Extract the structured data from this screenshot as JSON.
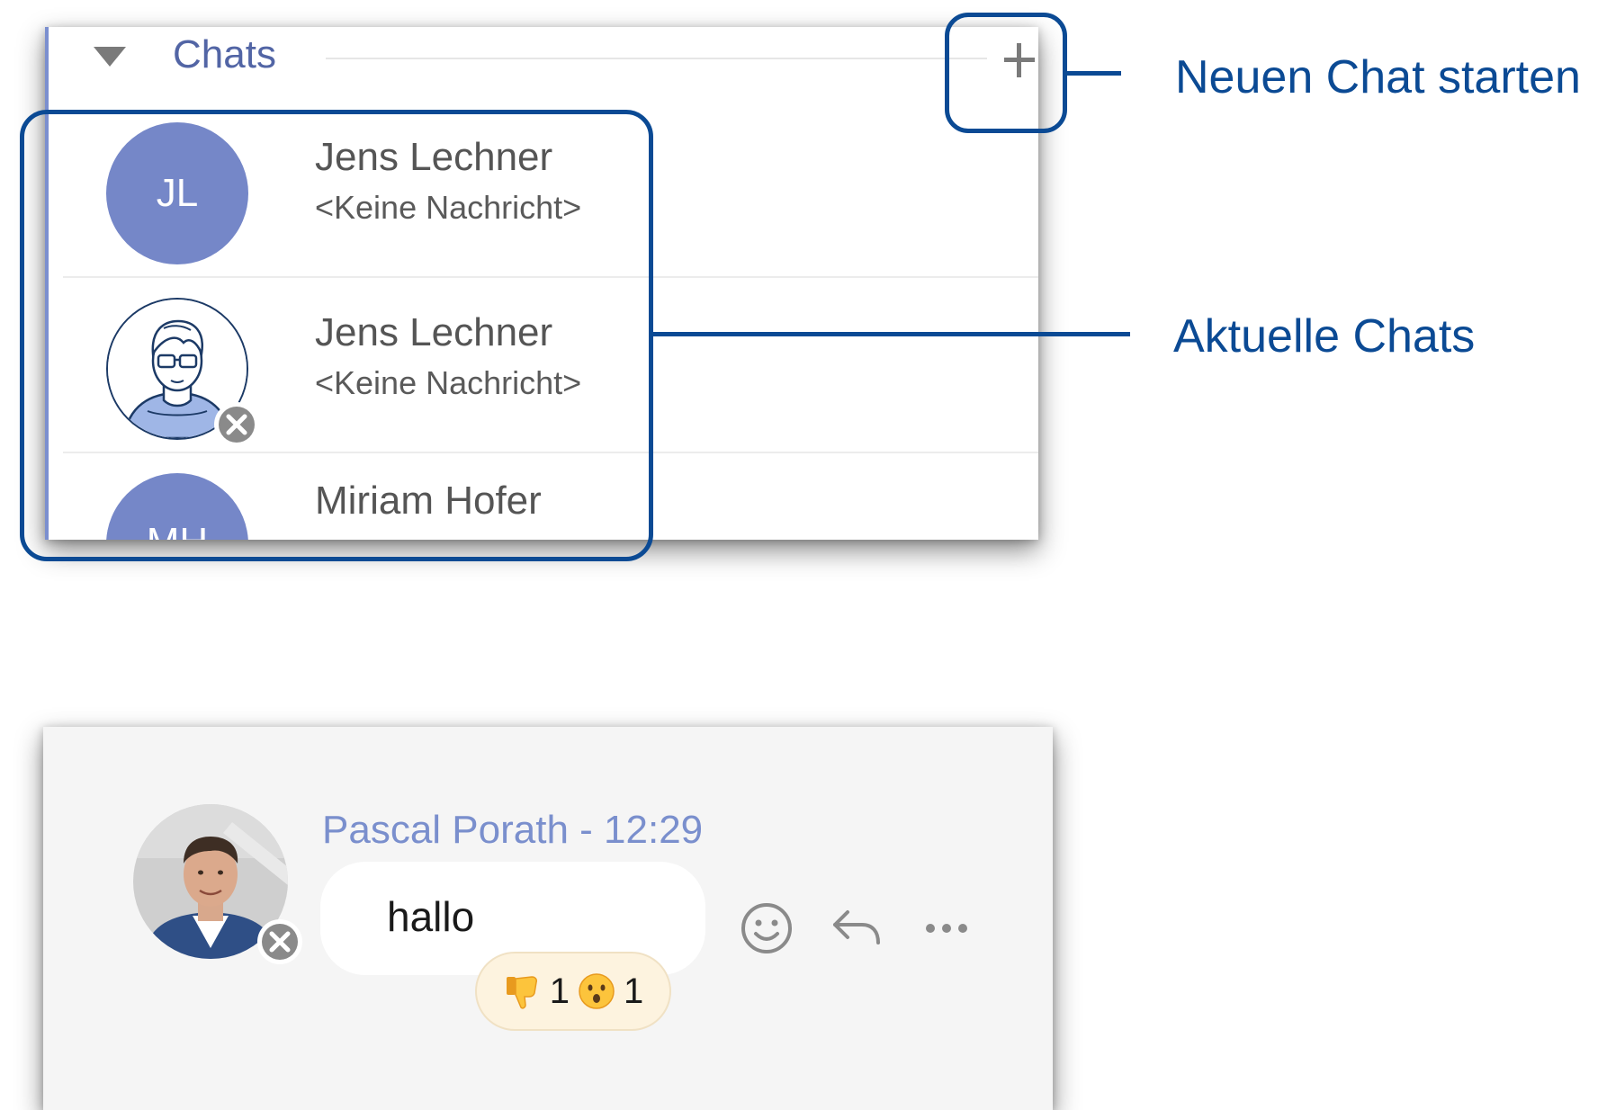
{
  "chat_list": {
    "section_title": "Chats",
    "collapse_icon": "triangle-down-icon",
    "add_icon": "plus-icon",
    "accent_color": "#7b8fcf",
    "chats": [
      {
        "name": "Jens Lechner",
        "preview": "<Keine Nachricht>",
        "avatar_type": "initials",
        "initials": "JL",
        "status_icon": "offline-x-icon"
      },
      {
        "name": "Jens Lechner",
        "preview": "<Keine Nachricht>",
        "avatar_type": "illustration",
        "status_icon": "offline-x-icon"
      },
      {
        "name": "Miriam Hofer",
        "avatar_type": "initials",
        "initials": "MH"
      }
    ]
  },
  "callouts": {
    "new_chat": "Neuen Chat starten",
    "recent_chats": "Aktuelle Chats",
    "color": "#0b4a94"
  },
  "message": {
    "sender": "Pascal Porath - 12:29",
    "text": "hallo",
    "avatar_type": "photo",
    "status_icon": "offline-x-icon",
    "reactions": [
      {
        "icon": "thumbs-down-emoji",
        "count": "1"
      },
      {
        "icon": "hushed-face-emoji",
        "count": "1"
      }
    ],
    "actions": [
      "smiley-icon",
      "reply-icon",
      "more-icon"
    ]
  }
}
